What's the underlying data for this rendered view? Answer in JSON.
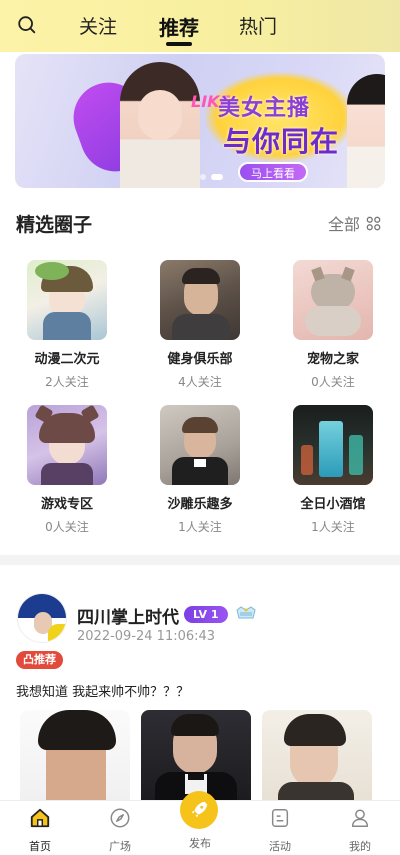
{
  "header": {
    "tabs": [
      {
        "label": "关注"
      },
      {
        "label": "推荐"
      },
      {
        "label": "热门"
      }
    ],
    "active_tab": "推荐"
  },
  "banner": {
    "brand": "LIKE",
    "line1": "美女主播",
    "line2": "与你同在",
    "cta": "马上看看"
  },
  "section": {
    "title": "精选圈子",
    "see_all": "全部"
  },
  "circles": [
    {
      "name": "动漫二次元",
      "followers": "2人关注"
    },
    {
      "name": "健身俱乐部",
      "followers": "4人关注"
    },
    {
      "name": "宠物之家",
      "followers": "0人关注"
    },
    {
      "name": "游戏专区",
      "followers": "0人关注"
    },
    {
      "name": "沙雕乐趣多",
      "followers": "1人关注"
    },
    {
      "name": "全日小酒馆",
      "followers": "1人关注"
    }
  ],
  "post": {
    "author": "四川掌上时代",
    "level": "LV 1",
    "time": "2022-09-24 11:06:43",
    "tag": "推荐",
    "text": "我想知道 我起来帅不帅？？？"
  },
  "bottom_nav": [
    {
      "label": "首页"
    },
    {
      "label": "广场"
    },
    {
      "label": "发布"
    },
    {
      "label": "活动"
    },
    {
      "label": "我的"
    }
  ],
  "colors": {
    "header_bg": "#fdf3a8",
    "accent_yellow": "#f5c319",
    "level_purple": "#7b3fe4",
    "tag_red": "#e24a3b"
  }
}
